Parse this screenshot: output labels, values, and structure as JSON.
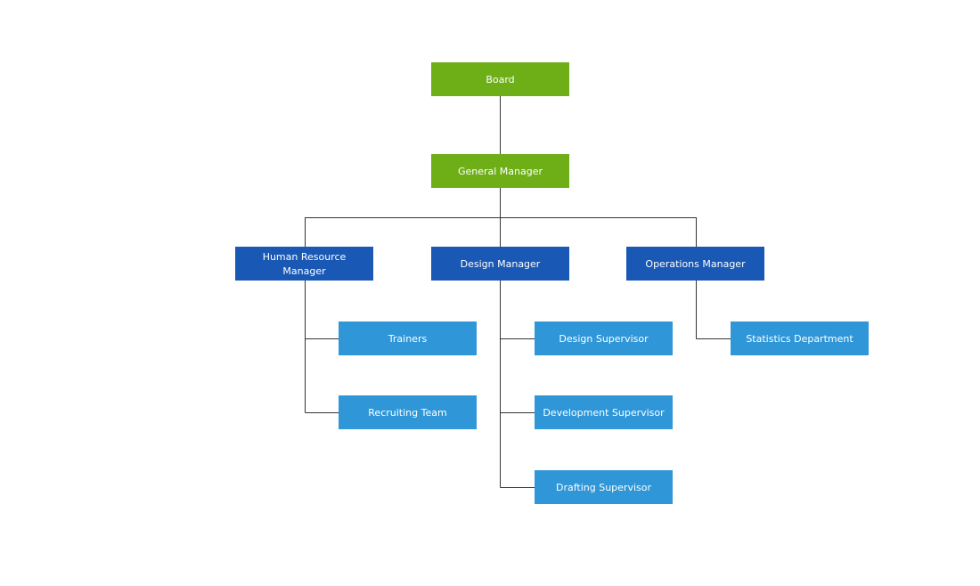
{
  "colors": {
    "top": "#6eaf18",
    "manager": "#1a58b5",
    "team": "#2f96d8",
    "connector": "#333333"
  },
  "nodes": {
    "board": {
      "label": "Board"
    },
    "general_manager": {
      "label": "General Manager"
    },
    "hr_manager": {
      "label_line1": "Human Resource",
      "label_line2": "Manager"
    },
    "design_manager": {
      "label": "Design Manager"
    },
    "operations_manager": {
      "label": "Operations Manager"
    },
    "trainers": {
      "label": "Trainers"
    },
    "recruiting_team": {
      "label": "Recruiting Team"
    },
    "design_supervisor": {
      "label": "Design Supervisor"
    },
    "development_supervisor": {
      "label": "Development Supervisor"
    },
    "drafting_supervisor": {
      "label": "Drafting Supervisor"
    },
    "statistics_department": {
      "label": "Statistics Department"
    }
  }
}
